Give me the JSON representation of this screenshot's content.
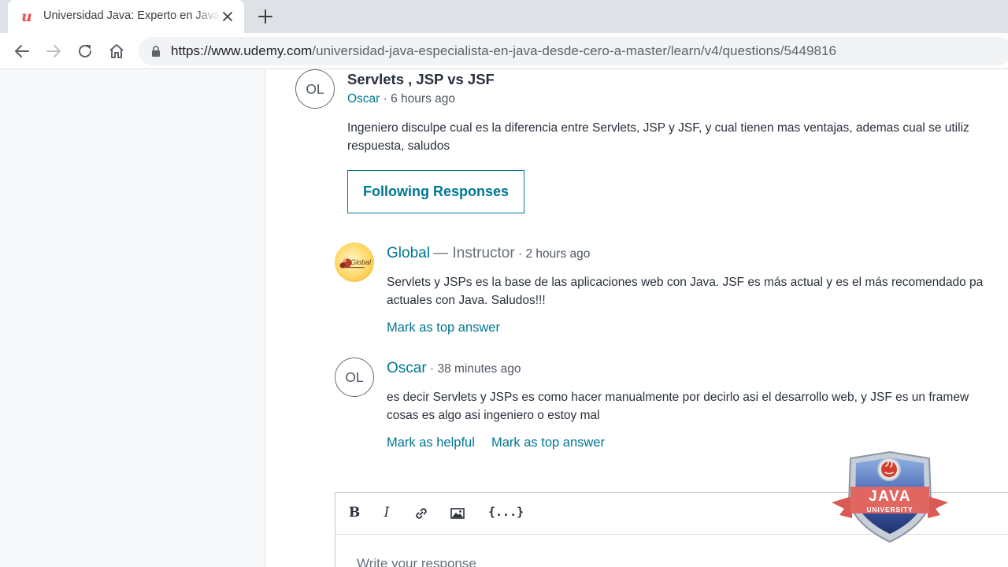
{
  "browser": {
    "tab_title": "Universidad Java: Experto en Java",
    "url_host": "https://www.udemy.com",
    "url_path": "/universidad-java-especialista-en-java-desde-cero-a-master/learn/v4/questions/5449816"
  },
  "question": {
    "avatar_initials": "OL",
    "title": "Servlets , JSP vs JSF",
    "author": "Oscar",
    "time": "· 6 hours ago",
    "body_line1": "Ingeniero disculpe cual es la diferencia entre Servlets, JSP y JSF, y cual tienen mas ventajas, ademas cual se utiliz",
    "body_line2": "respuesta, saludos",
    "follow_button": "Following Responses"
  },
  "responses": [
    {
      "author": "Global",
      "role": "— Instructor",
      "time": "· 2 hours ago",
      "logo_text": "Global",
      "body_line1": "Servlets y JSPs es la base de las aplicaciones web con Java. JSF es más actual y es el más recomendado pa",
      "body_line2": "actuales con Java. Saludos!!!",
      "actions": [
        "Mark as top answer"
      ]
    },
    {
      "avatar_initials": "OL",
      "author": "Oscar",
      "time": "· 38 minutes ago",
      "body_line1": "es decir Servlets y JSPs es como hacer manualmente por decirlo asi el desarrollo web, y JSF es un framew",
      "body_line2": "cosas es algo asi ingeniero o estoy mal",
      "actions": [
        "Mark as helpful",
        "Mark as top answer"
      ]
    }
  ],
  "editor": {
    "tools": [
      "B",
      "I",
      "link",
      "image",
      "{...}"
    ],
    "code_label": "{...}",
    "placeholder": "Write your response"
  },
  "watermark": {
    "title": "JAVA",
    "subtitle": "UNIVERSITY"
  },
  "colors": {
    "link": "#007791",
    "brand_red": "#ec5252",
    "text": "#29303b"
  }
}
